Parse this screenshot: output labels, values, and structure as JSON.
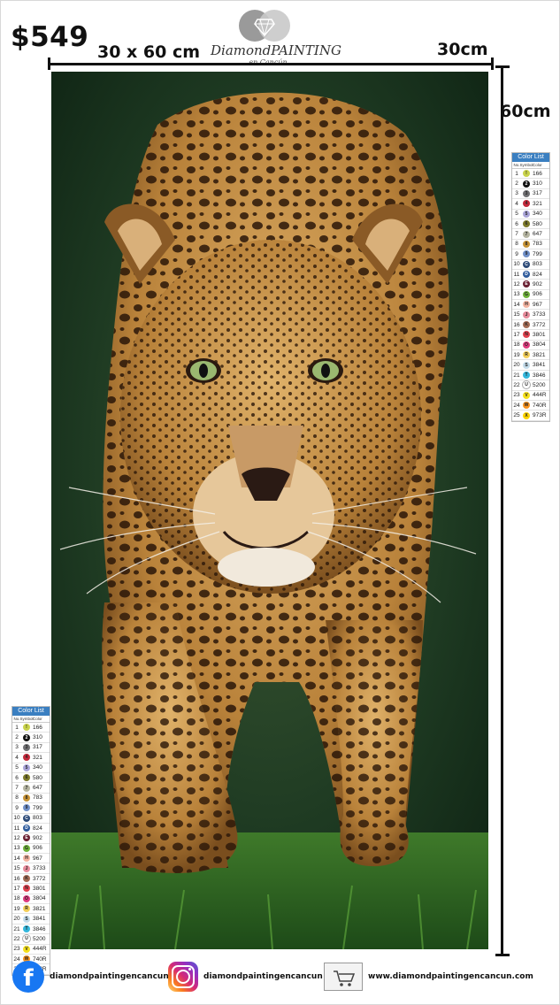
{
  "product": {
    "price": "$549",
    "size": "30 x 60 cm",
    "width_label": "30cm",
    "height_label": "60cm",
    "subject": "leopard-walking-toward-viewer"
  },
  "logo": {
    "name": "DiamondPAINTING",
    "sub": "en Cancún"
  },
  "color_list": {
    "title": "Color List",
    "headers": [
      "No.",
      "Symbol",
      "Color"
    ],
    "rows": [
      {
        "no": "1",
        "sym": "!",
        "code": "166",
        "color": "#c8d24a"
      },
      {
        "no": "2",
        "sym": "2",
        "code": "310",
        "color": "#111111"
      },
      {
        "no": "3",
        "sym": "3",
        "code": "317",
        "color": "#6f6f72"
      },
      {
        "no": "4",
        "sym": "4",
        "code": "321",
        "color": "#c2283a"
      },
      {
        "no": "5",
        "sym": "5",
        "code": "340",
        "color": "#a9a4d8"
      },
      {
        "no": "6",
        "sym": "6",
        "code": "580",
        "color": "#7d7a2a"
      },
      {
        "no": "7",
        "sym": "7",
        "code": "647",
        "color": "#b4b4a0"
      },
      {
        "no": "8",
        "sym": "8",
        "code": "783",
        "color": "#c69234"
      },
      {
        "no": "9",
        "sym": "9",
        "code": "799",
        "color": "#6f8fc8"
      },
      {
        "no": "10",
        "sym": "C",
        "code": "803",
        "color": "#2c4a78"
      },
      {
        "no": "11",
        "sym": "D",
        "code": "824",
        "color": "#2e5b9c"
      },
      {
        "no": "12",
        "sym": "E",
        "code": "902",
        "color": "#6a2032"
      },
      {
        "no": "13",
        "sym": "G",
        "code": "906",
        "color": "#6fb23a"
      },
      {
        "no": "14",
        "sym": "H",
        "code": "967",
        "color": "#f3b3a0"
      },
      {
        "no": "15",
        "sym": "J",
        "code": "3733",
        "color": "#e68a9a"
      },
      {
        "no": "16",
        "sym": "K",
        "code": "3772",
        "color": "#a46b54"
      },
      {
        "no": "17",
        "sym": "N",
        "code": "3801",
        "color": "#e2404e"
      },
      {
        "no": "18",
        "sym": "O",
        "code": "3804",
        "color": "#de3b7e"
      },
      {
        "no": "19",
        "sym": "R",
        "code": "3821",
        "color": "#f3cf5a"
      },
      {
        "no": "20",
        "sym": "S",
        "code": "3841",
        "color": "#c4dcea"
      },
      {
        "no": "21",
        "sym": "T",
        "code": "3846",
        "color": "#33b7dc"
      },
      {
        "no": "22",
        "sym": "U",
        "code": "5200",
        "color": "#ffffff"
      },
      {
        "no": "23",
        "sym": "V",
        "code": "444R",
        "color": "#f4df1d"
      },
      {
        "no": "24",
        "sym": "W",
        "code": "740R",
        "color": "#f7921e"
      },
      {
        "no": "25",
        "sym": "X",
        "code": "973R",
        "color": "#fbd300"
      }
    ]
  },
  "footer": {
    "facebook": "diamondpaintingencancun",
    "instagram": "diamondpaintingencancun",
    "website": "www.diamondpaintingencancun.com"
  },
  "colors": {
    "facebook_blue": "#1877f2",
    "list_header_blue": "#3a7fc1",
    "background_green": "#1f3a22",
    "leopard_gold": "#c8913f"
  }
}
